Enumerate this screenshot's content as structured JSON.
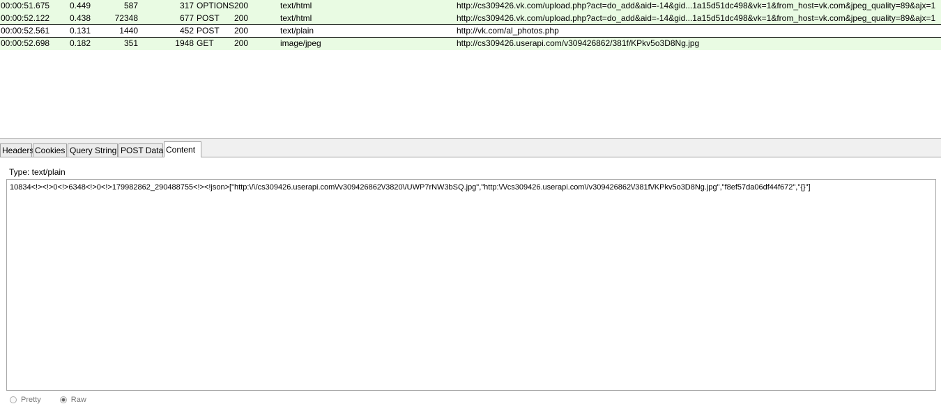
{
  "requests": [
    {
      "time": "00:00:51.675",
      "duration": "0.449",
      "sent": "587",
      "received": "317",
      "method": "OPTIONS",
      "status": "200",
      "type": "text/html",
      "url": "http://cs309426.vk.com/upload.php?act=do_add&aid=-14&gid...1a15d51dc498&vk=1&from_host=vk.com&jpeg_quality=89&ajx=1"
    },
    {
      "time": "00:00:52.122",
      "duration": "0.438",
      "sent": "72348",
      "received": "677",
      "method": "POST",
      "status": "200",
      "type": "text/html",
      "url": "http://cs309426.vk.com/upload.php?act=do_add&aid=-14&gid...1a15d51dc498&vk=1&from_host=vk.com&jpeg_quality=89&ajx=1"
    },
    {
      "time": "00:00:52.561",
      "duration": "0.131",
      "sent": "1440",
      "received": "452",
      "method": "POST",
      "status": "200",
      "type": "text/plain",
      "url": "http://vk.com/al_photos.php"
    },
    {
      "time": "00:00:52.698",
      "duration": "0.182",
      "sent": "351",
      "received": "1948",
      "method": "GET",
      "status": "200",
      "type": "image/jpeg",
      "url": "http://cs309426.userapi.com/v309426862/381f/KPkv5o3D8Ng.jpg"
    }
  ],
  "tabs": [
    "Headers",
    "Cookies",
    "Query String",
    "POST Data",
    "Content"
  ],
  "active_tab": "Content",
  "content": {
    "type_label": "Type: text/plain",
    "body": "10834<!><!>0<!>6348<!>0<!>179982862_290488755<!><!json>[\"http:\\/\\/cs309426.userapi.com\\/v309426862\\/3820\\/UWP7rNW3bSQ.jpg\",\"http:\\/\\/cs309426.userapi.com\\/v309426862\\/381f\\/KPkv5o3D8Ng.jpg\",\"f8ef57da06df44f672\",\"{}\"]"
  },
  "view_options": {
    "pretty": "Pretty",
    "raw": "Raw"
  }
}
